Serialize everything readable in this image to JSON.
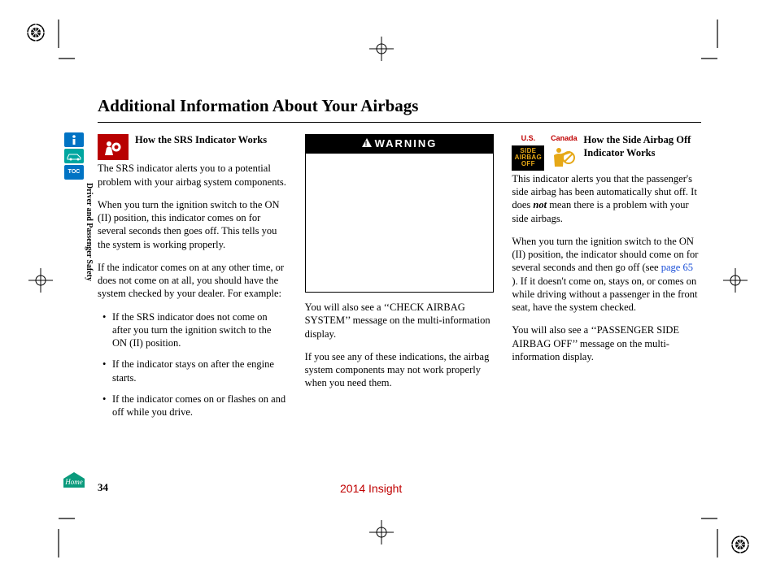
{
  "title": "Additional Information About Your Airbags",
  "section_label": "Driver and Passenger Safety",
  "page_number": "34",
  "model_year": "2014 Insight",
  "nav": {
    "toc_label": "TOC"
  },
  "col1": {
    "header": "How the SRS Indicator Works",
    "p1": "The SRS indicator alerts you to a potential problem with your airbag system components.",
    "p2": "When you turn the ignition switch to the ON (II) position, this indicator comes on for several seconds then goes off. This tells you the system is working properly.",
    "p3": "If the indicator comes on at any other time, or does not come on at all, you should have the system checked by your dealer. For example:",
    "b1": "If the SRS indicator does not come on after you turn the ignition switch to the ON (II) position.",
    "b2": "If the indicator stays on after the engine starts.",
    "b3": "If the indicator comes on or flashes on and off while you drive."
  },
  "col2": {
    "warning_label": "WARNING",
    "p1": "You will also see a ‘‘CHECK AIRBAG SYSTEM’’ message on the multi-information display.",
    "p2": "If you see any of these indications, the airbag system components may not work properly when you need them."
  },
  "col3": {
    "us_label": "U.S.",
    "canada_label": "Canada",
    "us_icon_l1": "SIDE",
    "us_icon_l2": "AIRBAG",
    "us_icon_l3": "OFF",
    "header": "How the Side Airbag Off Indicator Works",
    "p1_a": "This indicator alerts you that the passenger's side airbag has been automatically shut off. It does ",
    "p1_em": "not",
    "p1_b": " mean there is a problem with your side airbags.",
    "p2_a": "When you turn the ignition switch to the ON (II) position, the indicator should come on for several seconds and then go off (see ",
    "p2_link": "page 65",
    "p2_b": " ). If it  doesn't come on, stays on, or comes  on while driving without a passenger  in the front seat, have the system checked.",
    "p3": "You will also see a ‘‘PASSENGER SIDE AIRBAG OFF’’ message on the multi-information display."
  }
}
